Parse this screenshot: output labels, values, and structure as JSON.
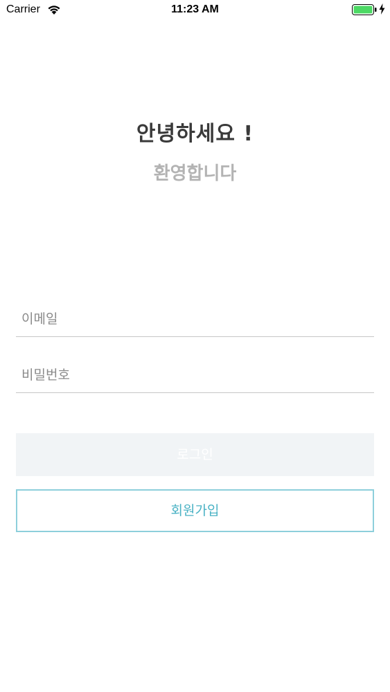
{
  "status_bar": {
    "carrier": "Carrier",
    "time": "11:23 AM",
    "icons": [
      "wifi-icon",
      "battery-icon",
      "charging-icon"
    ],
    "battery_color": "#4cd964"
  },
  "header": {
    "greeting": "안녕하세요 !",
    "welcome": "환영합니다"
  },
  "form": {
    "email_placeholder": "이메일",
    "email_value": "",
    "password_placeholder": "비밀번호",
    "password_value": ""
  },
  "buttons": {
    "login_label": "로그인",
    "signup_label": "회원가입"
  },
  "colors": {
    "accent": "#4ab2c4",
    "login_disabled_bg": "#f1f4f6",
    "welcome_text": "#b3b3b3"
  }
}
